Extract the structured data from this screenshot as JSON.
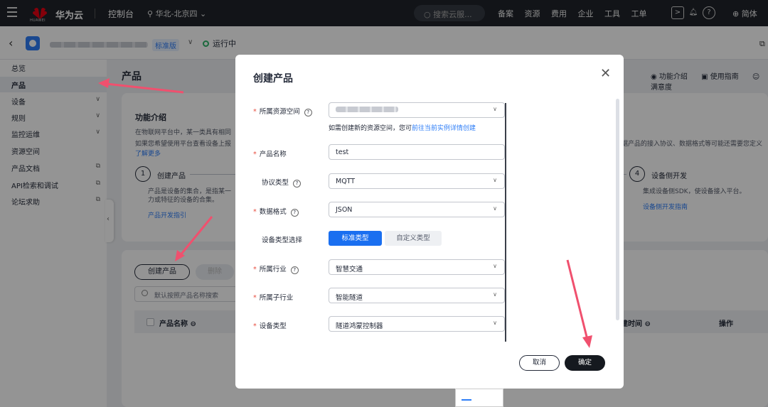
{
  "topbar": {
    "logo_sub": "HUAWEI",
    "brand": "华为云",
    "console": "控制台",
    "region": "华北-北京四",
    "search_placeholder": "搜索云服...",
    "nav": [
      "备案",
      "资源",
      "费用",
      "企业",
      "工具",
      "工单"
    ],
    "lang": "简体"
  },
  "subbar": {
    "edition": "标准版",
    "status": "运行中"
  },
  "sidebar": {
    "items": [
      {
        "label": "总览",
        "chevron": false,
        "external": false,
        "active": false
      },
      {
        "label": "产品",
        "chevron": false,
        "external": false,
        "active": true
      },
      {
        "label": "设备",
        "chevron": true,
        "external": false,
        "active": false
      },
      {
        "label": "规则",
        "chevron": true,
        "external": false,
        "active": false
      },
      {
        "label": "监控运维",
        "chevron": true,
        "external": false,
        "active": false
      },
      {
        "label": "资源空间",
        "chevron": false,
        "external": false,
        "active": false
      },
      {
        "label": "产品文档",
        "chevron": false,
        "external": true,
        "active": false
      },
      {
        "label": "API检索和调试",
        "chevron": false,
        "external": true,
        "active": false
      },
      {
        "label": "论坛求助",
        "chevron": false,
        "external": true,
        "active": false
      }
    ]
  },
  "main": {
    "title": "产品",
    "links": [
      "功能介绍",
      "使用指南",
      "满意度"
    ],
    "intro": {
      "title": "功能介绍",
      "desc1": "在物联网平台中，某一类具有相同",
      "desc2": "如果您希望使用平台查看设备上报",
      "more": "了解更多",
      "right_desc": "据产品的接入协议、数据格式等可能还需要您定义",
      "step1": {
        "num": "1",
        "title": "创建产品",
        "desc1": "产品是设备的集合，是指某一",
        "desc2": "力或特征的设备的合集。",
        "link": "产品开发指引"
      },
      "step4": {
        "num": "4",
        "title": "设备侧开发",
        "desc1": "集成设备侧SDK，使设备接入平台。",
        "link": "设备侧开发指南"
      }
    },
    "table": {
      "create_btn": "创建产品",
      "delete_btn": "删除",
      "search_placeholder": "默认按照产品名称搜索",
      "col_name": "产品名称",
      "col_time": "建时间",
      "col_op": "操作"
    }
  },
  "modal": {
    "title": "创建产品",
    "hint_text": "如需创建新的资源空间，您可",
    "hint_link": "前往当前实例详情创建",
    "fields": {
      "space_label": "所属资源空间",
      "name_label": "产品名称",
      "name_value": "test",
      "protocol_label": "协议类型",
      "protocol_value": "MQTT",
      "format_label": "数据格式",
      "format_value": "JSON",
      "devtype_select_label": "设备类型选择",
      "seg_standard": "标准类型",
      "seg_custom": "自定义类型",
      "industry_label": "所属行业",
      "industry_value": "智慧交通",
      "subindustry_label": "所属子行业",
      "subindustry_value": "智能隧道",
      "devtype_label": "设备类型",
      "devtype_value": "隧道鸿蒙控制器"
    },
    "cancel": "取消",
    "ok": "确定"
  },
  "colors": {
    "accent": "#1a6ff0",
    "required": "#e84e40",
    "annotation_arrow": "#f0506e"
  }
}
